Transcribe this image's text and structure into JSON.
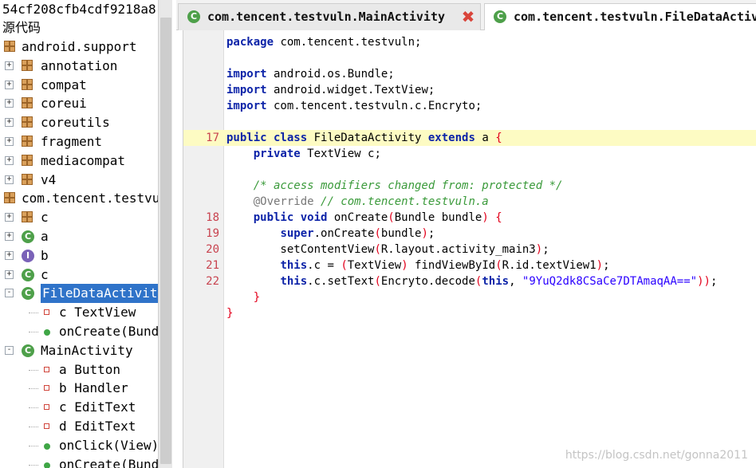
{
  "tree": {
    "header": "54cf208cfb4cdf9218a8",
    "source_label": "源代码",
    "nodes": [
      {
        "label": "android.support",
        "type": "package",
        "depth": 0,
        "expander": ""
      },
      {
        "label": "annotation",
        "type": "package",
        "depth": 1,
        "expander": "+"
      },
      {
        "label": "compat",
        "type": "package",
        "depth": 1,
        "expander": "+"
      },
      {
        "label": "coreui",
        "type": "package",
        "depth": 1,
        "expander": "+"
      },
      {
        "label": "coreutils",
        "type": "package",
        "depth": 1,
        "expander": "+"
      },
      {
        "label": "fragment",
        "type": "package",
        "depth": 1,
        "expander": "+"
      },
      {
        "label": "mediacompat",
        "type": "package",
        "depth": 1,
        "expander": "+"
      },
      {
        "label": "v4",
        "type": "package",
        "depth": 1,
        "expander": "+"
      },
      {
        "label": "com.tencent.testvuln",
        "type": "package",
        "depth": 0,
        "expander": ""
      },
      {
        "label": "c",
        "type": "package",
        "depth": 1,
        "expander": "+"
      },
      {
        "label": "a",
        "type": "class",
        "depth": 1,
        "expander": "+"
      },
      {
        "label": "b",
        "type": "interface",
        "depth": 1,
        "expander": "+"
      },
      {
        "label": "c",
        "type": "class",
        "depth": 1,
        "expander": "+"
      },
      {
        "label": "FileDataActivity",
        "type": "class",
        "depth": 1,
        "expander": "-",
        "selected": true
      },
      {
        "label": "c TextView",
        "type": "field",
        "depth": 2,
        "expander": ""
      },
      {
        "label": "onCreate(Bundle)",
        "type": "method",
        "depth": 2,
        "expander": ""
      },
      {
        "label": "MainActivity",
        "type": "class",
        "depth": 1,
        "expander": "-"
      },
      {
        "label": "a Button",
        "type": "field",
        "depth": 2,
        "expander": ""
      },
      {
        "label": "b Handler",
        "type": "field",
        "depth": 2,
        "expander": ""
      },
      {
        "label": "c EditText",
        "type": "field",
        "depth": 2,
        "expander": ""
      },
      {
        "label": "d EditText",
        "type": "field",
        "depth": 2,
        "expander": ""
      },
      {
        "label": "onClick(View)",
        "type": "method",
        "depth": 2,
        "expander": ""
      },
      {
        "label": "onCreate(Bundle)",
        "type": "method",
        "depth": 2,
        "expander": ""
      }
    ]
  },
  "tabs": [
    {
      "label": "com.tencent.testvuln.MainActivity",
      "icon": "class-icon",
      "active": false,
      "close_glyph": "✖"
    },
    {
      "label": "com.tencent.testvuln.FileDataActivity",
      "icon": "class-icon",
      "active": true
    }
  ],
  "editor": {
    "lines": [
      {
        "num": "",
        "segments": [
          {
            "t": "package",
            "c": "kw"
          },
          {
            "t": " com.tencent.testvuln;"
          }
        ]
      },
      {
        "num": "",
        "segments": []
      },
      {
        "num": "",
        "segments": [
          {
            "t": "import",
            "c": "kw"
          },
          {
            "t": " android.os.Bundle;"
          }
        ]
      },
      {
        "num": "",
        "segments": [
          {
            "t": "import",
            "c": "kw"
          },
          {
            "t": " android.widget.TextView;"
          }
        ]
      },
      {
        "num": "",
        "segments": [
          {
            "t": "import",
            "c": "kw"
          },
          {
            "t": " com.tencent.testvuln.c.Encryto;"
          }
        ]
      },
      {
        "num": "",
        "segments": []
      },
      {
        "num": "17",
        "highlight": true,
        "segments": [
          {
            "t": "public class",
            "c": "kw"
          },
          {
            "t": " FileDataActivity "
          },
          {
            "t": "extends",
            "c": "kw"
          },
          {
            "t": " a "
          },
          {
            "t": "{",
            "c": "br"
          }
        ]
      },
      {
        "num": "",
        "segments": [
          {
            "t": "    "
          },
          {
            "t": "private",
            "c": "kw"
          },
          {
            "t": " TextView c;"
          }
        ]
      },
      {
        "num": "",
        "segments": []
      },
      {
        "num": "",
        "segments": [
          {
            "t": "    "
          },
          {
            "t": "/* access modifiers changed from: protected */",
            "c": "cm"
          }
        ]
      },
      {
        "num": "",
        "segments": [
          {
            "t": "    "
          },
          {
            "t": "@Override",
            "c": "ann"
          },
          {
            "t": " "
          },
          {
            "t": "// com.tencent.testvuln.a",
            "c": "cm"
          }
        ]
      },
      {
        "num": "18",
        "segments": [
          {
            "t": "    "
          },
          {
            "t": "public void",
            "c": "kw"
          },
          {
            "t": " onCreate"
          },
          {
            "t": "(",
            "c": "br"
          },
          {
            "t": "Bundle bundle"
          },
          {
            "t": ")",
            "c": "br"
          },
          {
            "t": " "
          },
          {
            "t": "{",
            "c": "br"
          }
        ]
      },
      {
        "num": "19",
        "segments": [
          {
            "t": "        "
          },
          {
            "t": "super",
            "c": "kw"
          },
          {
            "t": ".onCreate"
          },
          {
            "t": "(",
            "c": "br"
          },
          {
            "t": "bundle"
          },
          {
            "t": ")",
            "c": "br"
          },
          {
            "t": ";"
          }
        ]
      },
      {
        "num": "20",
        "segments": [
          {
            "t": "        setContentView"
          },
          {
            "t": "(",
            "c": "br"
          },
          {
            "t": "R.layout.activity_main3"
          },
          {
            "t": ")",
            "c": "br"
          },
          {
            "t": ";"
          }
        ]
      },
      {
        "num": "21",
        "segments": [
          {
            "t": "        "
          },
          {
            "t": "this",
            "c": "kw"
          },
          {
            "t": ".c = "
          },
          {
            "t": "(",
            "c": "br"
          },
          {
            "t": "TextView"
          },
          {
            "t": ")",
            "c": "br"
          },
          {
            "t": " findViewById"
          },
          {
            "t": "(",
            "c": "br"
          },
          {
            "t": "R.id.textView1"
          },
          {
            "t": ")",
            "c": "br"
          },
          {
            "t": ";"
          }
        ]
      },
      {
        "num": "22",
        "segments": [
          {
            "t": "        "
          },
          {
            "t": "this",
            "c": "kw"
          },
          {
            "t": ".c.setText"
          },
          {
            "t": "(",
            "c": "br"
          },
          {
            "t": "Encryto.decode"
          },
          {
            "t": "(",
            "c": "br"
          },
          {
            "t": "this",
            "c": "kw"
          },
          {
            "t": ", "
          },
          {
            "t": "\"9YuQ2dk8CSaCe7DTAmaqAA==\"",
            "c": "str"
          },
          {
            "t": ")",
            "c": "br"
          },
          {
            "t": ")",
            "c": "br"
          },
          {
            "t": ";"
          }
        ]
      },
      {
        "num": "",
        "segments": [
          {
            "t": "    "
          },
          {
            "t": "}",
            "c": "br"
          }
        ]
      },
      {
        "num": "",
        "segments": [
          {
            "t": "}",
            "c": "br"
          }
        ]
      }
    ]
  },
  "watermark": "https://blog.csdn.net/gonna2011"
}
